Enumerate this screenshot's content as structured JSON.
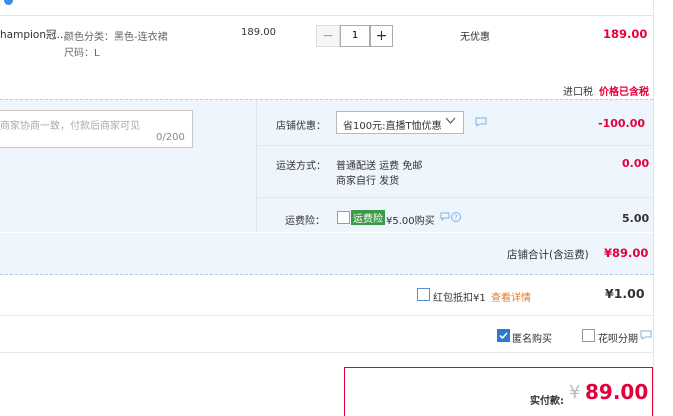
{
  "item": {
    "title": "hampion冠...",
    "sku_color": "颜色分类：黑色-连衣裙",
    "sku_size": "尺码：L",
    "unit_price": "189.00",
    "quantity": "1",
    "minus": "−",
    "plus": "+",
    "promo": "无优惠",
    "subtotal": "189.00"
  },
  "tax": {
    "label": "进口税",
    "value": "价格已含税"
  },
  "message": {
    "placeholder": "商家协商一致，付款后商家可见",
    "counter": "0/200"
  },
  "store_discount": {
    "label": "店铺优惠：",
    "selected": "省100元:直播T恤优惠",
    "value": "-100.00"
  },
  "shipping": {
    "label": "运送方式：",
    "line1": "普通配送 运费 免邮",
    "line2": "商家自行  发货",
    "value": "0.00"
  },
  "insurance": {
    "label": "运费险：",
    "badge": "运费险",
    "price": "¥5.00购买",
    "value": "5.00"
  },
  "store_total": {
    "label": "店铺合计(含运费)",
    "value": "¥89.00"
  },
  "redpacket": {
    "label": "红包抵扣¥1",
    "link": "查看详情",
    "value": "¥1.00"
  },
  "options": {
    "anonymous": "匿名购买",
    "huabei": "花呗分期"
  },
  "payment": {
    "label": "实付款:",
    "currency": "¥",
    "amount": "89.00"
  },
  "colors": {
    "accent_red": "#e4003a",
    "panel_blue": "#eff5fc",
    "link_orange": "#e07b2a",
    "checkbox_blue": "#2e78d2"
  }
}
